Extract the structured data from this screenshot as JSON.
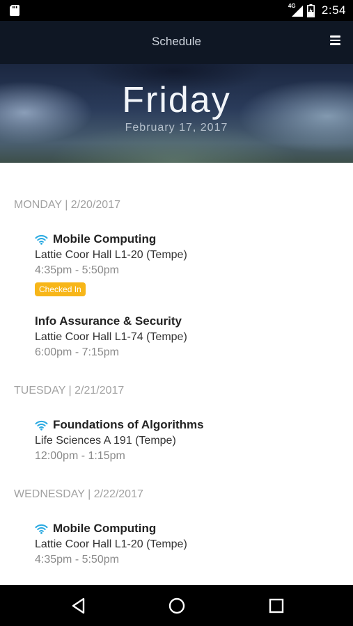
{
  "status_bar": {
    "network": "4G",
    "time": "2:54",
    "icons": [
      "sd-card-icon",
      "signal-icon",
      "battery-icon"
    ]
  },
  "app_bar": {
    "title": "Schedule",
    "menu_icon": "hamburger-menu-icon"
  },
  "hero": {
    "day": "Friday",
    "date": "February 17, 2017"
  },
  "schedule": [
    {
      "header": "MONDAY | 2/20/2017",
      "classes": [
        {
          "title": "Mobile Computing",
          "location": "Lattie Coor Hall L1-20 (Tempe)",
          "time": "4:35pm - 5:50pm",
          "wifi": true,
          "badge": "Checked In"
        },
        {
          "title": "Info Assurance & Security",
          "location": "Lattie Coor Hall L1-74 (Tempe)",
          "time": "6:00pm - 7:15pm",
          "wifi": false
        }
      ]
    },
    {
      "header": "TUESDAY | 2/21/2017",
      "classes": [
        {
          "title": "Foundations of Algorithms",
          "location": "Life Sciences A 191 (Tempe)",
          "time": "12:00pm - 1:15pm",
          "wifi": true
        }
      ]
    },
    {
      "header": "WEDNESDAY | 2/22/2017",
      "classes": [
        {
          "title": "Mobile Computing",
          "location": "Lattie Coor Hall L1-20 (Tempe)",
          "time": "4:35pm - 5:50pm",
          "wifi": true
        }
      ]
    }
  ],
  "colors": {
    "app_bar": "#0f1724",
    "wifi": "#29a9e1",
    "badge": "#f7b619",
    "header_text": "#a2a2a2"
  },
  "nav_bar": {
    "icons": [
      "back-icon",
      "home-icon",
      "recents-icon"
    ]
  }
}
